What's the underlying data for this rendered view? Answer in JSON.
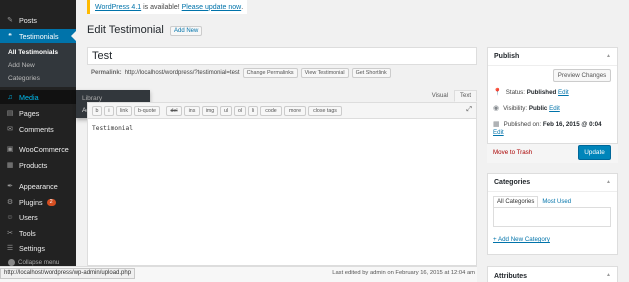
{
  "sidebar": {
    "items": [
      {
        "id": "posts",
        "label": "Posts",
        "icon": "pin-icon",
        "glyph": "✎"
      },
      {
        "id": "testimonials",
        "label": "Testimonials",
        "icon": "quote-icon",
        "glyph": "❝"
      },
      {
        "id": "media",
        "label": "Media",
        "icon": "media-icon",
        "glyph": "♫"
      },
      {
        "id": "pages",
        "label": "Pages",
        "icon": "page-icon",
        "glyph": "▤"
      },
      {
        "id": "comments",
        "label": "Comments",
        "icon": "comment-icon",
        "glyph": "✉"
      },
      {
        "id": "woocommerce",
        "label": "WooCommerce",
        "icon": "woocommerce-icon",
        "glyph": "▣"
      },
      {
        "id": "products",
        "label": "Products",
        "icon": "products-icon",
        "glyph": "▦"
      },
      {
        "id": "appearance",
        "label": "Appearance",
        "icon": "brush-icon",
        "glyph": "✒"
      },
      {
        "id": "plugins",
        "label": "Plugins",
        "icon": "plugin-icon",
        "glyph": "⚙",
        "badge": "2"
      },
      {
        "id": "users",
        "label": "Users",
        "icon": "users-icon",
        "glyph": "☺"
      },
      {
        "id": "tools",
        "label": "Tools",
        "icon": "wrench-icon",
        "glyph": "✂"
      },
      {
        "id": "settings",
        "label": "Settings",
        "icon": "settings-icon",
        "glyph": "☰"
      }
    ],
    "submenu": [
      "All Testimonials",
      "Add New",
      "Categories"
    ],
    "collapse_label": "Collapse menu"
  },
  "flyout": {
    "items": [
      "Library",
      "Add New"
    ]
  },
  "notice": {
    "link1": "WordPress 4.1",
    "middle": " is available! ",
    "link2": "Please update now",
    "end": "."
  },
  "page": {
    "title": "Edit Testimonial",
    "add_new": "Add New"
  },
  "post": {
    "title": "Test",
    "permalink_label": "Permalink:",
    "permalink": "http://localhost/wordpress/?testimonial=test",
    "buttons": [
      "Change Permalinks",
      "View Testimonial",
      "Get Shortlink"
    ]
  },
  "editor": {
    "tabs": [
      "Visual",
      "Text"
    ],
    "active_tab": "Text",
    "quicktags": [
      "b",
      "i",
      "link",
      "b-quote",
      "del",
      "ins",
      "img",
      "ul",
      "ol",
      "li",
      "code",
      "more",
      "close tags"
    ],
    "content": "Testimonial",
    "last_edited": "Last edited by admin on February 16, 2015 at 12:04 am"
  },
  "status_url": "http://localhost/wordpress/wp-admin/upload.php",
  "publish": {
    "heading": "Publish",
    "preview": "Preview Changes",
    "status_label": "Status:",
    "status_value": "Published",
    "visibility_label": "Visibility:",
    "visibility_value": "Public",
    "published_label": "Published on:",
    "published_value": "Feb 16, 2015 @ 0:04",
    "edit": "Edit",
    "trash": "Move to Trash",
    "update": "Update"
  },
  "categories": {
    "heading": "Categories",
    "tabs": [
      "All Categories",
      "Most Used"
    ],
    "add_new": "+ Add New Category"
  },
  "attributes": {
    "heading": "Attributes"
  },
  "colors": {
    "accent": "#0073aa",
    "sidebar": "#222222",
    "button": "#0085ba"
  }
}
